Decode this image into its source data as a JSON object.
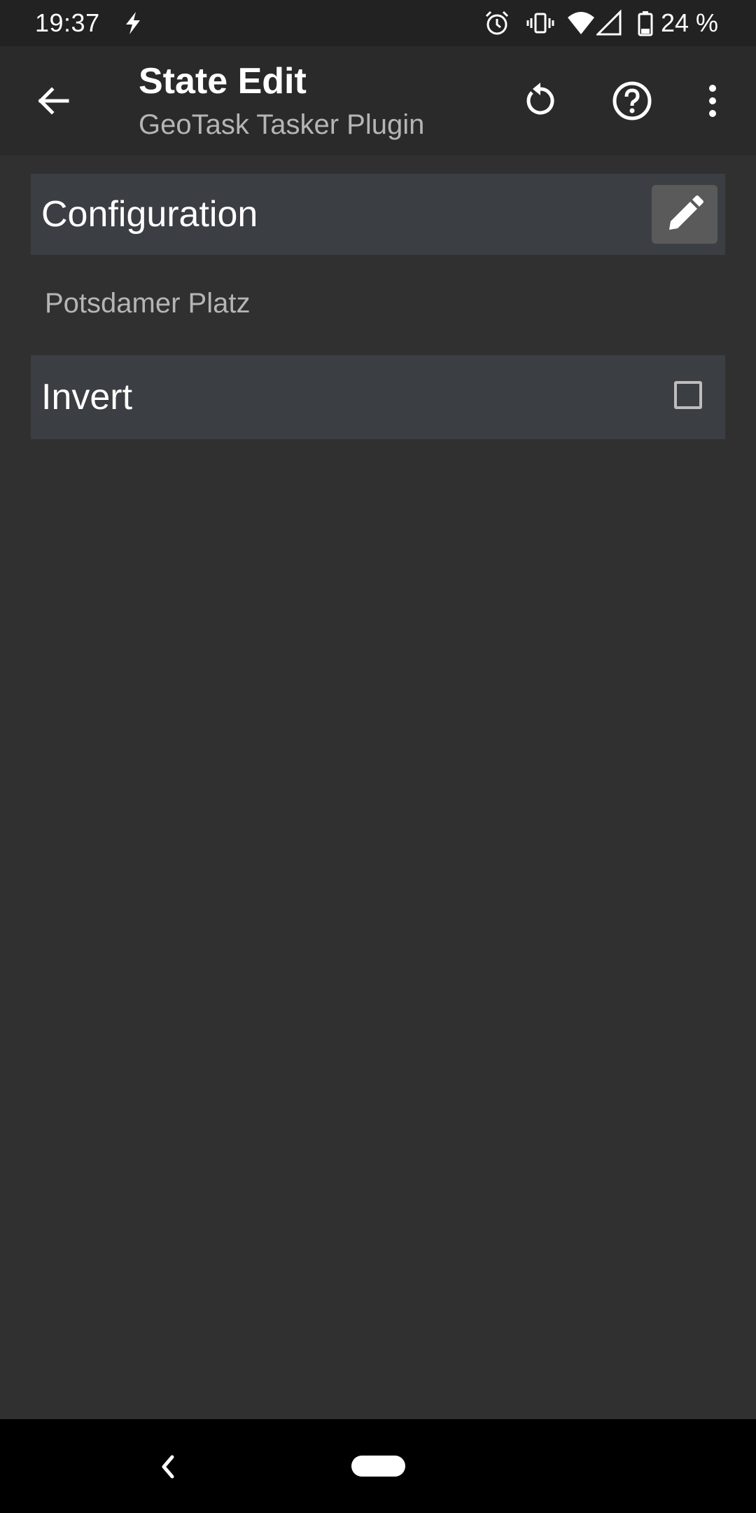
{
  "status_bar": {
    "time": "19:37",
    "battery_percent": "24 %",
    "icons": [
      "charging-bolt-icon",
      "alarm-icon",
      "vibrate-icon",
      "wifi-icon",
      "cell-signal-icon",
      "battery-icon"
    ]
  },
  "app_bar": {
    "title": "State Edit",
    "subtitle": "GeoTask Tasker Plugin",
    "actions": [
      "back-arrow-icon",
      "reset-icon",
      "help-icon",
      "more-vert-icon"
    ]
  },
  "configuration": {
    "label": "Configuration",
    "value": "Potsdamer Platz",
    "edit_icon": "pencil-icon"
  },
  "invert": {
    "label": "Invert",
    "checked": false
  },
  "colors": {
    "background": "#303030",
    "app_bar": "#2a2a2a",
    "row": "#3b3e42",
    "secondary_text": "#b5b5b5"
  }
}
